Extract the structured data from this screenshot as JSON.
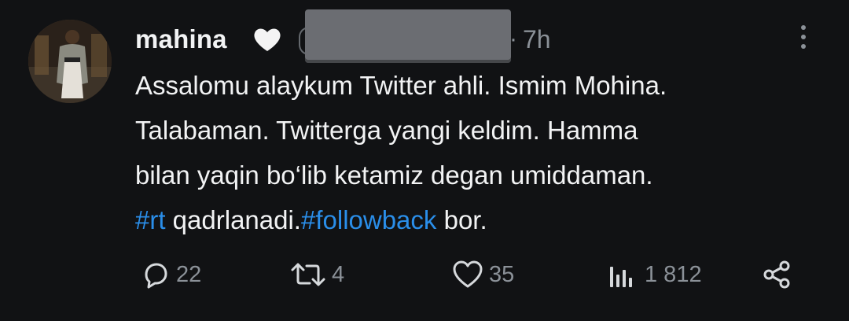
{
  "tweet": {
    "author_name": "mahina",
    "time": "7h",
    "separator": "·",
    "body": {
      "line1": "Assalomu alaykum Twitter ahli.  Ismim Mohina.",
      "line2": "Talabaman. Twitterga yangi keldim. Hamma",
      "line3": "bilan yaqin bo‘lib ketamiz degan umiddaman.",
      "hashtag1": "#rt",
      "mid_text": " qadrlanadi.",
      "hashtag2": "#followback",
      "end_text": " bor."
    },
    "stats": {
      "replies": "22",
      "reposts": "4",
      "likes": "35",
      "views": "1 812"
    }
  },
  "colors": {
    "background": "#111214",
    "text": "#f2f3f4",
    "muted": "#8b9198",
    "hashtag": "#2a8ee9"
  },
  "icons": [
    "white-heart-emoji-icon",
    "more-options-icon",
    "reply-icon",
    "repost-icon",
    "like-icon",
    "views-icon",
    "share-icon"
  ]
}
